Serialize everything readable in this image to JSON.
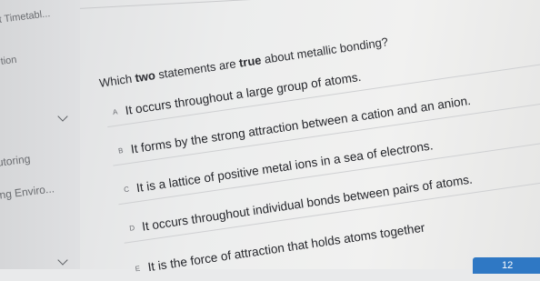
{
  "sidebar": {
    "items": [
      {
        "label": "t Timetabl..."
      },
      {
        "label": "tion"
      },
      {
        "label": "utoring"
      },
      {
        "label": "ing Enviro..."
      }
    ]
  },
  "question": {
    "prefix": "Which ",
    "emph1": "two",
    "middle": " statements are ",
    "emph2": "true",
    "suffix": " about metallic bonding?"
  },
  "options": [
    {
      "letter": "A",
      "text": "It occurs throughout a large group of atoms."
    },
    {
      "letter": "B",
      "text": "It forms by the strong attraction between a cation and an anion."
    },
    {
      "letter": "C",
      "text": "It is a lattice of positive metal ions in a sea of electrons."
    },
    {
      "letter": "D",
      "text": "It occurs throughout individual bonds between pairs of atoms."
    },
    {
      "letter": "E",
      "text": "It is the force of attraction that holds atoms together"
    }
  ],
  "footer": {
    "page_number": "12"
  }
}
